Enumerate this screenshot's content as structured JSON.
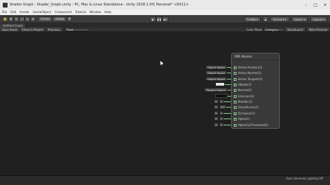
{
  "window": {
    "title": "Shader Graph - Shader_Graph.unity - PC, Mac & Linux Standalone - Unity 2018.1.0f1 Personal* <DX11>"
  },
  "menu": [
    "File",
    "Edit",
    "Assets",
    "GameObject",
    "Component",
    "Tutorial",
    "Window",
    "Help"
  ],
  "toolbar": {
    "tools": [
      "hand-icon",
      "move-icon",
      "rotate-icon",
      "scale-icon",
      "rect-icon",
      "transform-icon"
    ],
    "pivot_label": "Center",
    "space_label": "Global",
    "right": {
      "collab": "Collab ▾",
      "account": "Account ▾",
      "layers": "Layers ▾",
      "layout": "Layout ▾"
    }
  },
  "tab": {
    "label": "Untitled Graph"
  },
  "graphbar": {
    "save": "Save Asset",
    "show": "Show In Project",
    "precision_label": "Precision",
    "precision_value": "Float",
    "color_mode_label": "Color Mode",
    "color_mode_value": "Category",
    "blackboard": "Blackboard",
    "main_preview": "Main Preview"
  },
  "node": {
    "title": "PBR Master",
    "ports": [
      "Vertex Position(3)",
      "Vertex Normal(3)",
      "Vertex Tangent(3)",
      "Albedo(3)",
      "Normal(3)",
      "Emission(3)",
      "Metallic(1)",
      "Smoothness(1)",
      "Occlusion(1)",
      "Alpha(1)",
      "AlphaClipThreshold(1)"
    ]
  },
  "inputs": {
    "vpos": "Object Space",
    "vnorm": "Object Space",
    "vtan": "Object Space",
    "normal": "Tangent Space",
    "x": "X",
    "metallic": "0",
    "smoothness": "0.5",
    "occlusion": "1",
    "alpha": "1",
    "clip": "0"
  },
  "status": {
    "text": "Auto Generate Lighting Off"
  }
}
